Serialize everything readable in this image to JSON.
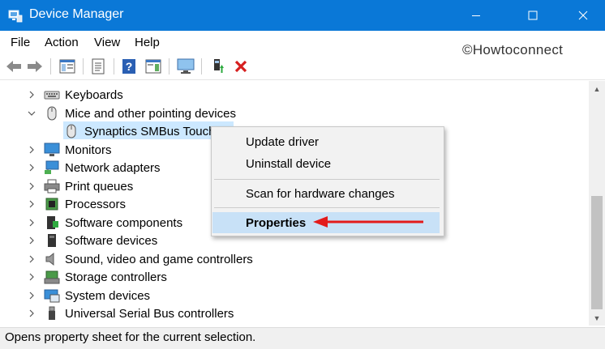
{
  "window": {
    "title": "Device Manager",
    "controls": [
      "minimize-icon",
      "maximize-icon",
      "close-icon"
    ],
    "accent_color": "#0a78d7"
  },
  "menubar": {
    "items": [
      "File",
      "Action",
      "View",
      "Help"
    ]
  },
  "watermark": "©Howtoconnect",
  "toolbar": {
    "buttons": [
      "back-arrow-icon",
      "forward-arrow-icon",
      "show-hide-console-tree-icon",
      "properties-icon",
      "help-icon",
      "action-pane-icon",
      "monitor-icon",
      "update-driver-icon",
      "uninstall-icon"
    ]
  },
  "tree": {
    "items": [
      {
        "label": "Keyboards",
        "icon": "keyboard-icon",
        "expanded": false
      },
      {
        "label": "Mice and other pointing devices",
        "icon": "mouse-icon",
        "expanded": true
      },
      {
        "label": "Synaptics SMBus Touchl",
        "icon": "mouse-icon",
        "child": true,
        "selected": true
      },
      {
        "label": "Monitors",
        "icon": "monitor-icon",
        "expanded": false
      },
      {
        "label": "Network adapters",
        "icon": "network-icon",
        "expanded": false
      },
      {
        "label": "Print queues",
        "icon": "printer-icon",
        "expanded": false
      },
      {
        "label": "Processors",
        "icon": "processor-icon",
        "expanded": false
      },
      {
        "label": "Software components",
        "icon": "software-component-icon",
        "expanded": false
      },
      {
        "label": "Software devices",
        "icon": "software-device-icon",
        "expanded": false
      },
      {
        "label": "Sound, video and game controllers",
        "icon": "speaker-icon",
        "expanded": false
      },
      {
        "label": "Storage controllers",
        "icon": "storage-icon",
        "expanded": false
      },
      {
        "label": "System devices",
        "icon": "system-icon",
        "expanded": false
      },
      {
        "label": "Universal Serial Bus controllers",
        "icon": "usb-icon",
        "expanded": false
      }
    ]
  },
  "context_menu": {
    "items": [
      "Update driver",
      "Uninstall device",
      "Scan for hardware changes",
      "Properties"
    ],
    "highlighted": "Properties",
    "annotation_arrow_color": "#e31b1b"
  },
  "status_bar": {
    "text": "Opens property sheet for the current selection."
  }
}
